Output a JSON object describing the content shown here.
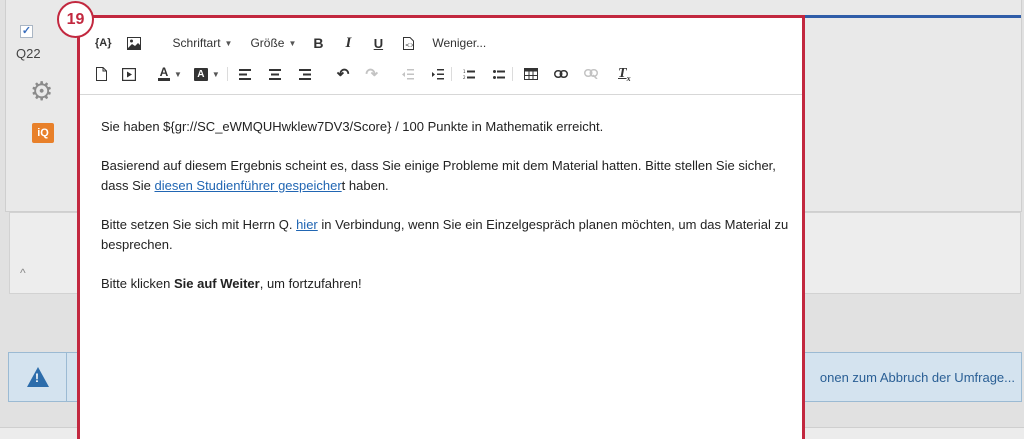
{
  "step_badge": "19",
  "question": {
    "label": "Q22",
    "check": "✓",
    "iq_label": "iQ"
  },
  "warning": {
    "text": "onen zum Abbruch der Umfrage..."
  },
  "toolbar": {
    "piped_text": "{A}",
    "font_label": "Schriftart",
    "size_label": "Größe",
    "bold": "B",
    "italic": "I",
    "underline": "U",
    "less_label": "Weniger...",
    "font_color": "A",
    "bg_color": "A",
    "clear_format": "Tx"
  },
  "content": {
    "p1": "Sie haben ${gr://SC_eWMQUHwklew7DV3/Score} / 100 Punkte in Mathematik erreicht.",
    "p2_before": "Basierend auf diesem Ergebnis scheint es, dass Sie einige Probleme mit dem Material hatten. Bitte stellen Sie sicher, dass Sie ",
    "p2_link": "diesen Studienführer gespeicher",
    "p2_after": "t haben.",
    "p3_before": "Bitte setzen Sie sich mit Herrn Q. ",
    "p3_link": "hier",
    "p3_after": " in Verbindung, wenn Sie ein Einzelgespräch planen möchten, um das Material zu besprechen.",
    "p4_before": "Bitte klicken ",
    "p4_bold": "Sie auf Weiter",
    "p4_after": ", um fortzufahren!"
  }
}
